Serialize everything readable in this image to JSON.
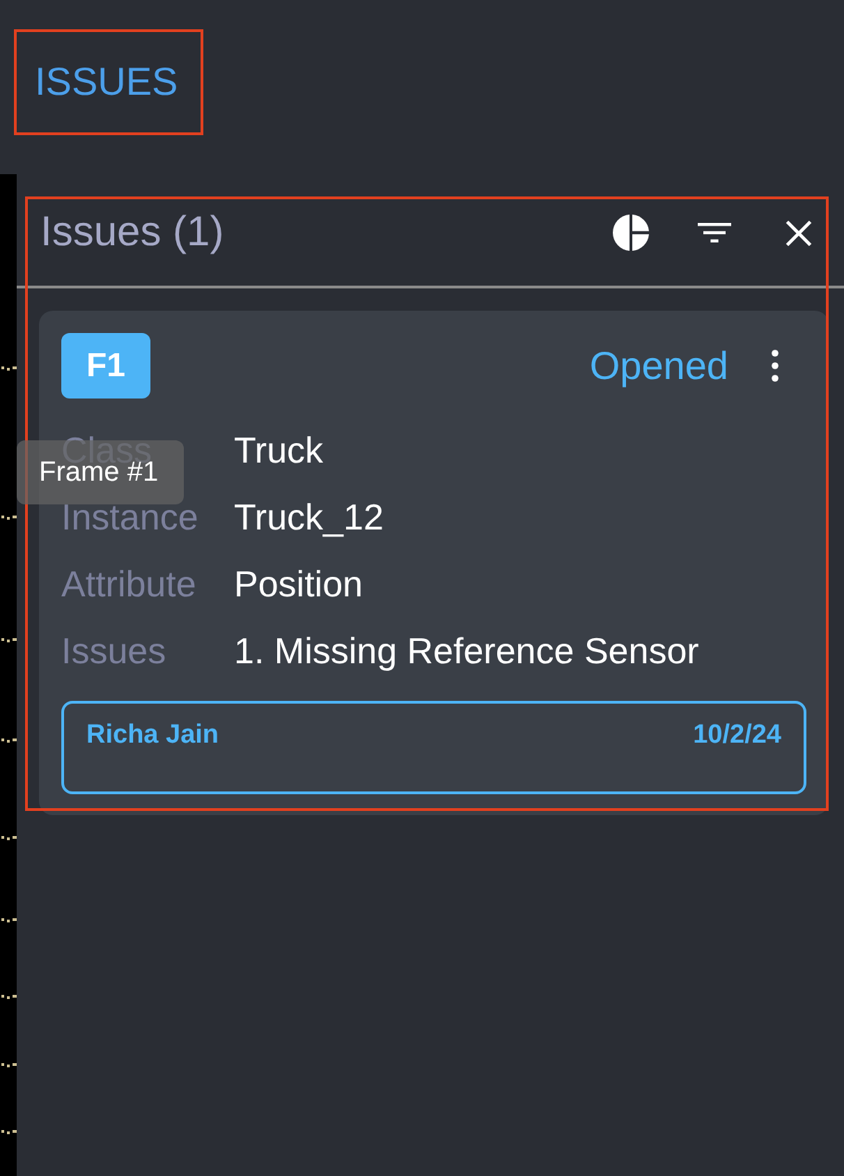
{
  "header": {
    "title": "ISSUES"
  },
  "panel": {
    "title": "Issues (1)"
  },
  "issues": [
    {
      "badge": "F1",
      "status": "Opened",
      "fields": [
        {
          "label": "Class",
          "value": "Truck"
        },
        {
          "label": "Instance",
          "value": "Truck_12"
        },
        {
          "label": "Attribute",
          "value": "Position"
        },
        {
          "label": "Issues",
          "value": "1. Missing Reference Sensor"
        }
      ],
      "comment": {
        "author": "Richa Jain",
        "date": "10/2/24"
      }
    }
  ],
  "tooltip": {
    "text": "Frame #1"
  }
}
